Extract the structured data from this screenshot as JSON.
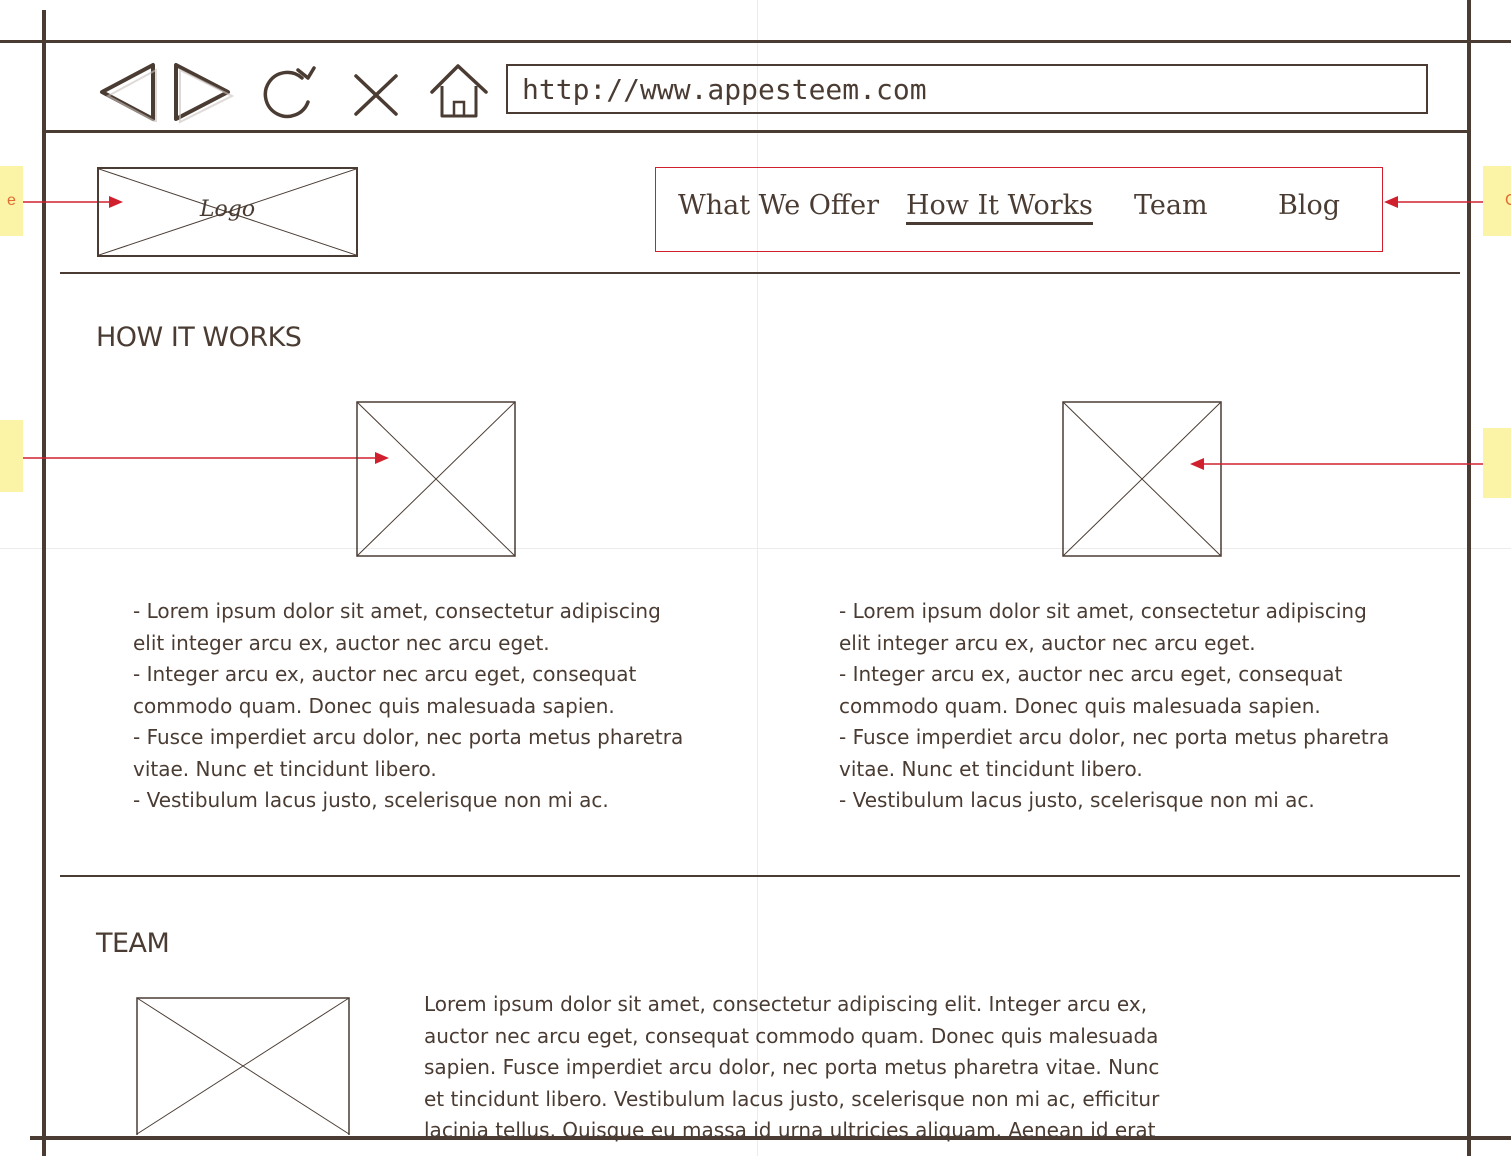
{
  "browser": {
    "url": "http://www.appesteem.com",
    "back_icon": "back-arrow-icon",
    "forward_icon": "forward-arrow-icon",
    "reload_icon": "reload-icon",
    "stop_icon": "close-icon",
    "home_icon": "home-icon"
  },
  "header": {
    "logo_label": "Logo",
    "nav": [
      {
        "label": "What We Offer",
        "active": false
      },
      {
        "label": "How It Works",
        "active": true
      },
      {
        "label": "Team",
        "active": false
      },
      {
        "label": "Blog",
        "active": false
      }
    ]
  },
  "how_it_works": {
    "title": "HOW IT WORKS",
    "left_column": [
      "- Lorem ipsum dolor sit amet, consectetur adipiscing",
      "elit integer arcu ex, auctor nec arcu eget.",
      "- Integer arcu ex, auctor nec arcu eget, consequat",
      "commodo quam. Donec quis malesuada sapien.",
      "- Fusce imperdiet arcu dolor, nec porta metus pharetra",
      "vitae. Nunc et tincidunt libero.",
      "- Vestibulum lacus justo, scelerisque non mi ac."
    ],
    "right_column": [
      "- Lorem ipsum dolor sit amet, consectetur adipiscing",
      "elit integer arcu ex, auctor nec arcu eget.",
      "- Integer arcu ex, auctor nec arcu eget, consequat",
      "commodo quam. Donec quis malesuada sapien.",
      "- Fusce imperdiet arcu dolor, nec porta metus pharetra",
      "vitae. Nunc et tincidunt libero.",
      "- Vestibulum lacus justo, scelerisque non mi ac."
    ]
  },
  "team": {
    "title": "TEAM",
    "paragraph": [
      "Lorem ipsum dolor sit amet, consectetur adipiscing elit. Integer arcu ex,",
      "auctor nec arcu eget, consequat commodo quam. Donec quis malesuada",
      "sapien. Fusce imperdiet arcu dolor, nec porta metus pharetra vitae. Nunc",
      "et tincidunt libero. Vestibulum lacus justo, scelerisque non mi ac, efficitur",
      "lacinia tellus. Quisque eu massa id urna ultricies aliquam. Aenean id erat"
    ]
  },
  "annotations": {
    "left_top_fragment": "e",
    "right_top_fragment": "C",
    "note_color": "#fbf3a6",
    "arrow_color": "#d0202e"
  },
  "colors": {
    "ink": "#4a3c33",
    "accent_red": "#d0202e",
    "note_yellow": "#fbf3a6"
  }
}
